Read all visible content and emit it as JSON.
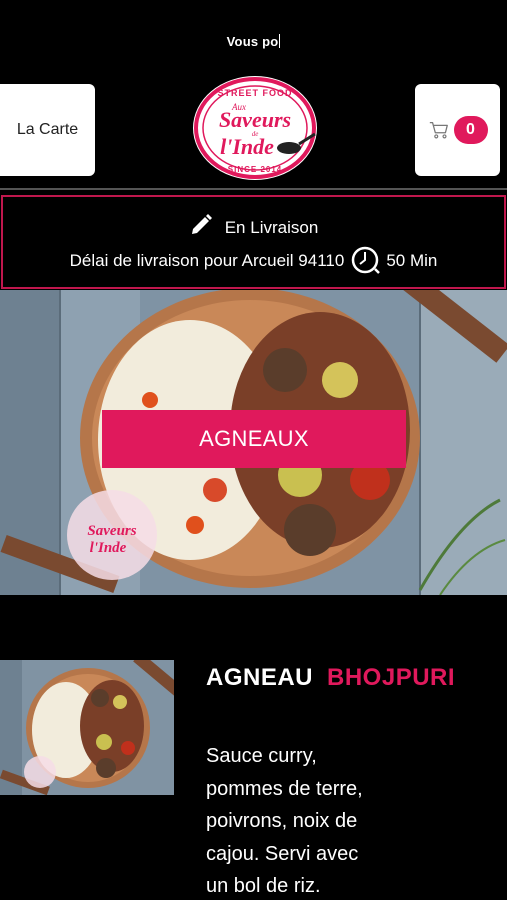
{
  "ticker": {
    "text": "Vous po"
  },
  "header": {
    "menu_label": "La Carte",
    "cart_count": "0",
    "logo": {
      "top_text": "STREET FOOD",
      "brand_line1": "Aux",
      "brand_line2": "Saveurs",
      "brand_line3": "de",
      "brand_line4": "l'Inde",
      "since": "SINCE 2014"
    }
  },
  "delivery": {
    "mode": "En Livraison",
    "delay_text": "Délai de livraison pour Arcueil 94110",
    "time": "50 Min"
  },
  "hero": {
    "category_label": "AGNEAUX"
  },
  "product": {
    "name_part1": "AGNEAU",
    "name_part2": "BHOJPURI",
    "description": "Sauce curry, pommes de terre, poivrons, noix de cajou.  Servi avec un bol de riz."
  },
  "colors": {
    "accent": "#e0195c",
    "background": "#000000",
    "border": "#c0174d"
  }
}
